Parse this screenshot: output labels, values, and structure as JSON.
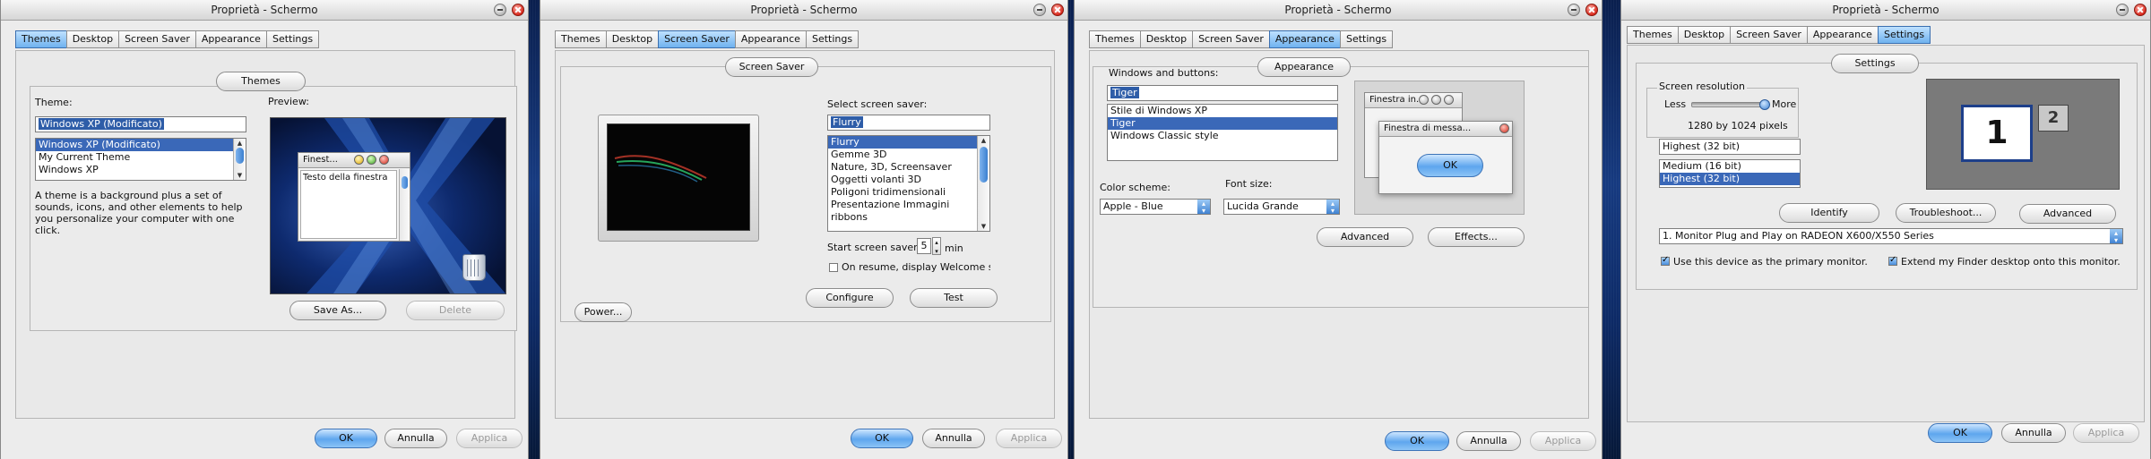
{
  "title": "Proprietà - Schermo",
  "tab_labels": [
    "Themes",
    "Desktop",
    "Screen Saver",
    "Appearance",
    "Settings"
  ],
  "buttons": {
    "ok": "OK",
    "cancel": "Annulla",
    "apply": "Applica"
  },
  "themes": {
    "group_title": "Themes",
    "theme_label": "Theme:",
    "preview_label": "Preview:",
    "theme_value": "Windows XP (Modificato)",
    "theme_options": [
      "Windows XP (Modificato)",
      "My Current Theme",
      "Windows XP"
    ],
    "description": "A theme is a background plus a set of sounds, icons, and other elements to help you personalize your computer with one click.",
    "preview_window_title": "Finest...",
    "preview_window_text": "Testo della finestra",
    "save_as": "Save As...",
    "delete": "Delete"
  },
  "screensaver": {
    "group_title": "Screen Saver",
    "select_label": "Select screen saver:",
    "value": "Flurry",
    "options": [
      "Flurry",
      "Gemme 3D",
      "Nature, 3D, Screensaver",
      "Oggetti volanti 3D",
      "Poligoni tridimensionali",
      "Presentazione Immagini",
      "ribbons"
    ],
    "start_label": "Start screen saver:",
    "minutes": "5",
    "min_unit": "min",
    "resume_label": "On resume, display Welcome s",
    "configure": "Configure",
    "test": "Test",
    "power": "Power..."
  },
  "appearance": {
    "group_title": "Appearance",
    "wb_label": "Windows and buttons:",
    "wb_value": "Tiger",
    "wb_options": [
      "Stile di Windows XP",
      "Tiger",
      "Windows Classic style"
    ],
    "color_label": "Color scheme:",
    "color_value": "Apple - Blue",
    "font_label": "Font size:",
    "font_value": "Lucida Grande",
    "preview_back_title": "Finestra in...",
    "preview_front_title": "Finestra di messa...",
    "preview_ok": "OK",
    "advanced": "Advanced",
    "effects": "Effects..."
  },
  "settings": {
    "group_title": "Settings",
    "res_label": "Screen resolution",
    "less": "Less",
    "more": "More",
    "res_value": "1280 by 1024 pixels",
    "slider_level": 0.95,
    "color_value": "Highest (32 bit)",
    "color_options": [
      "Medium (16 bit)",
      "Highest (32 bit)"
    ],
    "identify": "Identify",
    "troubleshoot": "Troubleshoot...",
    "advanced": "Advanced",
    "monitor_value": "1. Monitor Plug and Play on RADEON X600/X550 Series",
    "primary_label": "Use this device as the primary monitor.",
    "extend_label": "Extend my Finder desktop onto this monitor.",
    "monitor1": "1",
    "monitor2": "2"
  }
}
